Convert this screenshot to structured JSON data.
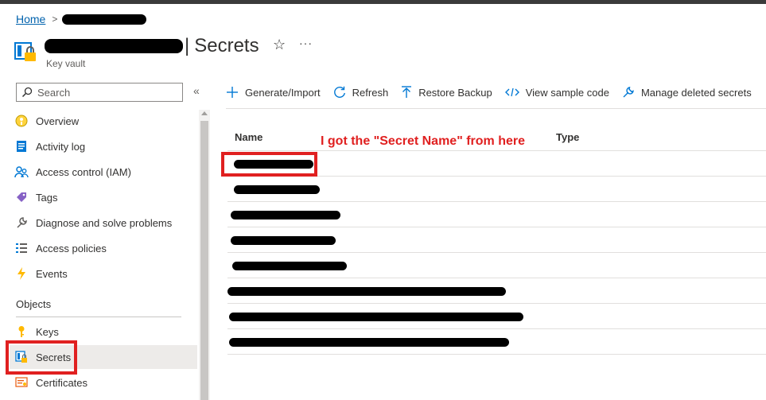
{
  "breadcrumb": {
    "home": "Home"
  },
  "header": {
    "title": "Secrets",
    "subtitle": "Key vault",
    "star_icon": "star-icon",
    "more_label": "···"
  },
  "sidebar": {
    "search_placeholder": "Search",
    "collapse_label": "«",
    "items": [
      {
        "label": "Overview",
        "icon": "overview-icon"
      },
      {
        "label": "Activity log",
        "icon": "activity-log-icon"
      },
      {
        "label": "Access control (IAM)",
        "icon": "people-icon"
      },
      {
        "label": "Tags",
        "icon": "tag-icon"
      },
      {
        "label": "Diagnose and solve problems",
        "icon": "wrench-icon"
      },
      {
        "label": "Access policies",
        "icon": "list-icon"
      },
      {
        "label": "Events",
        "icon": "lightning-icon"
      }
    ],
    "section_objects": "Objects",
    "object_items": [
      {
        "label": "Keys",
        "icon": "key-icon",
        "selected": false
      },
      {
        "label": "Secrets",
        "icon": "secret-icon",
        "selected": true
      },
      {
        "label": "Certificates",
        "icon": "certificate-icon",
        "selected": false
      }
    ]
  },
  "toolbar": {
    "generate": "Generate/Import",
    "refresh": "Refresh",
    "restore": "Restore Backup",
    "sample": "View sample code",
    "deleted": "Manage deleted secrets"
  },
  "table": {
    "columns": [
      "Name",
      "Type"
    ],
    "row_count": 8
  },
  "annotation": "I got the \"Secret Name\" from here",
  "colors": {
    "link": "#0062ad",
    "annotation": "#e02020",
    "selected_bg": "#edebe9",
    "accent_blue": "#0078d4"
  }
}
